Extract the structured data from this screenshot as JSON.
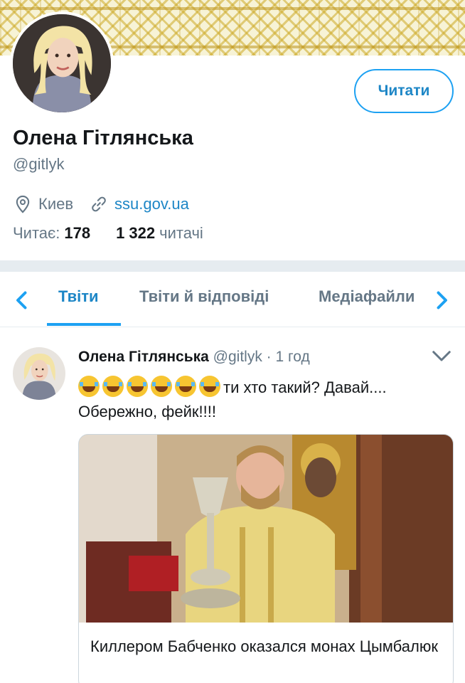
{
  "profile": {
    "name": "Олена Гітлянська",
    "handle": "@gitlyk",
    "follow_label": "Читати",
    "location": "Киев",
    "website": "ssu.gov.ua",
    "following_label": "Читає:",
    "following_count": "178",
    "followers_count": "1 322",
    "followers_label": "читачі"
  },
  "tabs": [
    {
      "label": "Твіти",
      "active": true
    },
    {
      "label": "Твіти й відповіді",
      "active": false
    },
    {
      "label": "Медіафайли",
      "active": false
    }
  ],
  "tweet": {
    "author_name": "Олена Гітлянська",
    "author_handle": "@gitlyk",
    "separator": "·",
    "time": "1 год",
    "emoji_count": 6,
    "emoji_name": "face-with-tears-of-joy",
    "text_line1": "ти хто такий? Давай....",
    "text_line2": "Обережно, фейк!!!!",
    "card_title": "Киллером Бабченко оказался монах Цымбалюк"
  },
  "colors": {
    "accent": "#1da1f2",
    "link": "#1d86c6",
    "secondary_text": "#657786",
    "separator": "#e6ecf0",
    "banner": "#f7f3d6"
  }
}
